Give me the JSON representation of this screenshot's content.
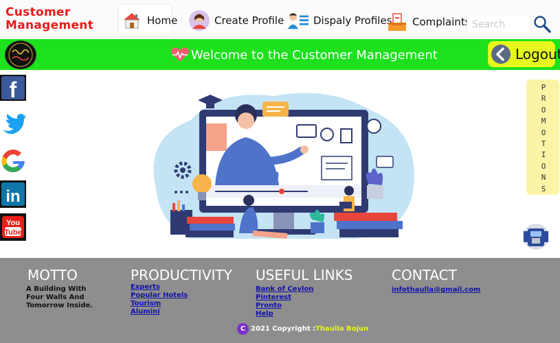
{
  "brand": {
    "line1": "Customer",
    "line2": "Management"
  },
  "nav": {
    "home": {
      "label": "Home",
      "icon": "house-icon"
    },
    "create_profile": {
      "label": "Create Profile",
      "icon": "person-avatar-icon"
    },
    "display_profiles": {
      "label": "Dispaly Profiles",
      "icon": "profile-list-icon"
    },
    "complaints": {
      "label": "Complaints",
      "icon": "complaint-box-icon"
    }
  },
  "search": {
    "placeholder": "Search"
  },
  "banner": {
    "welcome": "Welcome to the Customer Management",
    "logout_label": "Logout",
    "color": "#1ce11c"
  },
  "social": [
    "facebook-icon",
    "twitter-icon",
    "google-icon",
    "linkedin-icon",
    "youtube-icon"
  ],
  "promotions": {
    "label": "PROMOTIONS"
  },
  "footer": {
    "motto": {
      "title": "MOTTO",
      "lines": [
        "A Building With",
        "Four Walls And",
        "Tomorrow Inside."
      ]
    },
    "productivity": {
      "title": "PRODUCTIVITY",
      "links": [
        "Experts",
        "Popular Hotels",
        "Tourism",
        "Alumini"
      ]
    },
    "useful_links": {
      "title": "USEFUL LINKS",
      "links": [
        "Bank of Ceylon",
        "Pinterest",
        "Pronto",
        "Help"
      ]
    },
    "contact": {
      "title": "CONTACT",
      "email": "infothaulla@gmail.com"
    },
    "copyright": {
      "icon": "C",
      "text": "2021 Copyright :",
      "name": "Thaulla Bojun"
    }
  },
  "colors": {
    "brand": "#e81b1b",
    "logout": "#e5f71c",
    "footer": "#8e8e8e",
    "promo": "#fbf4a7"
  }
}
